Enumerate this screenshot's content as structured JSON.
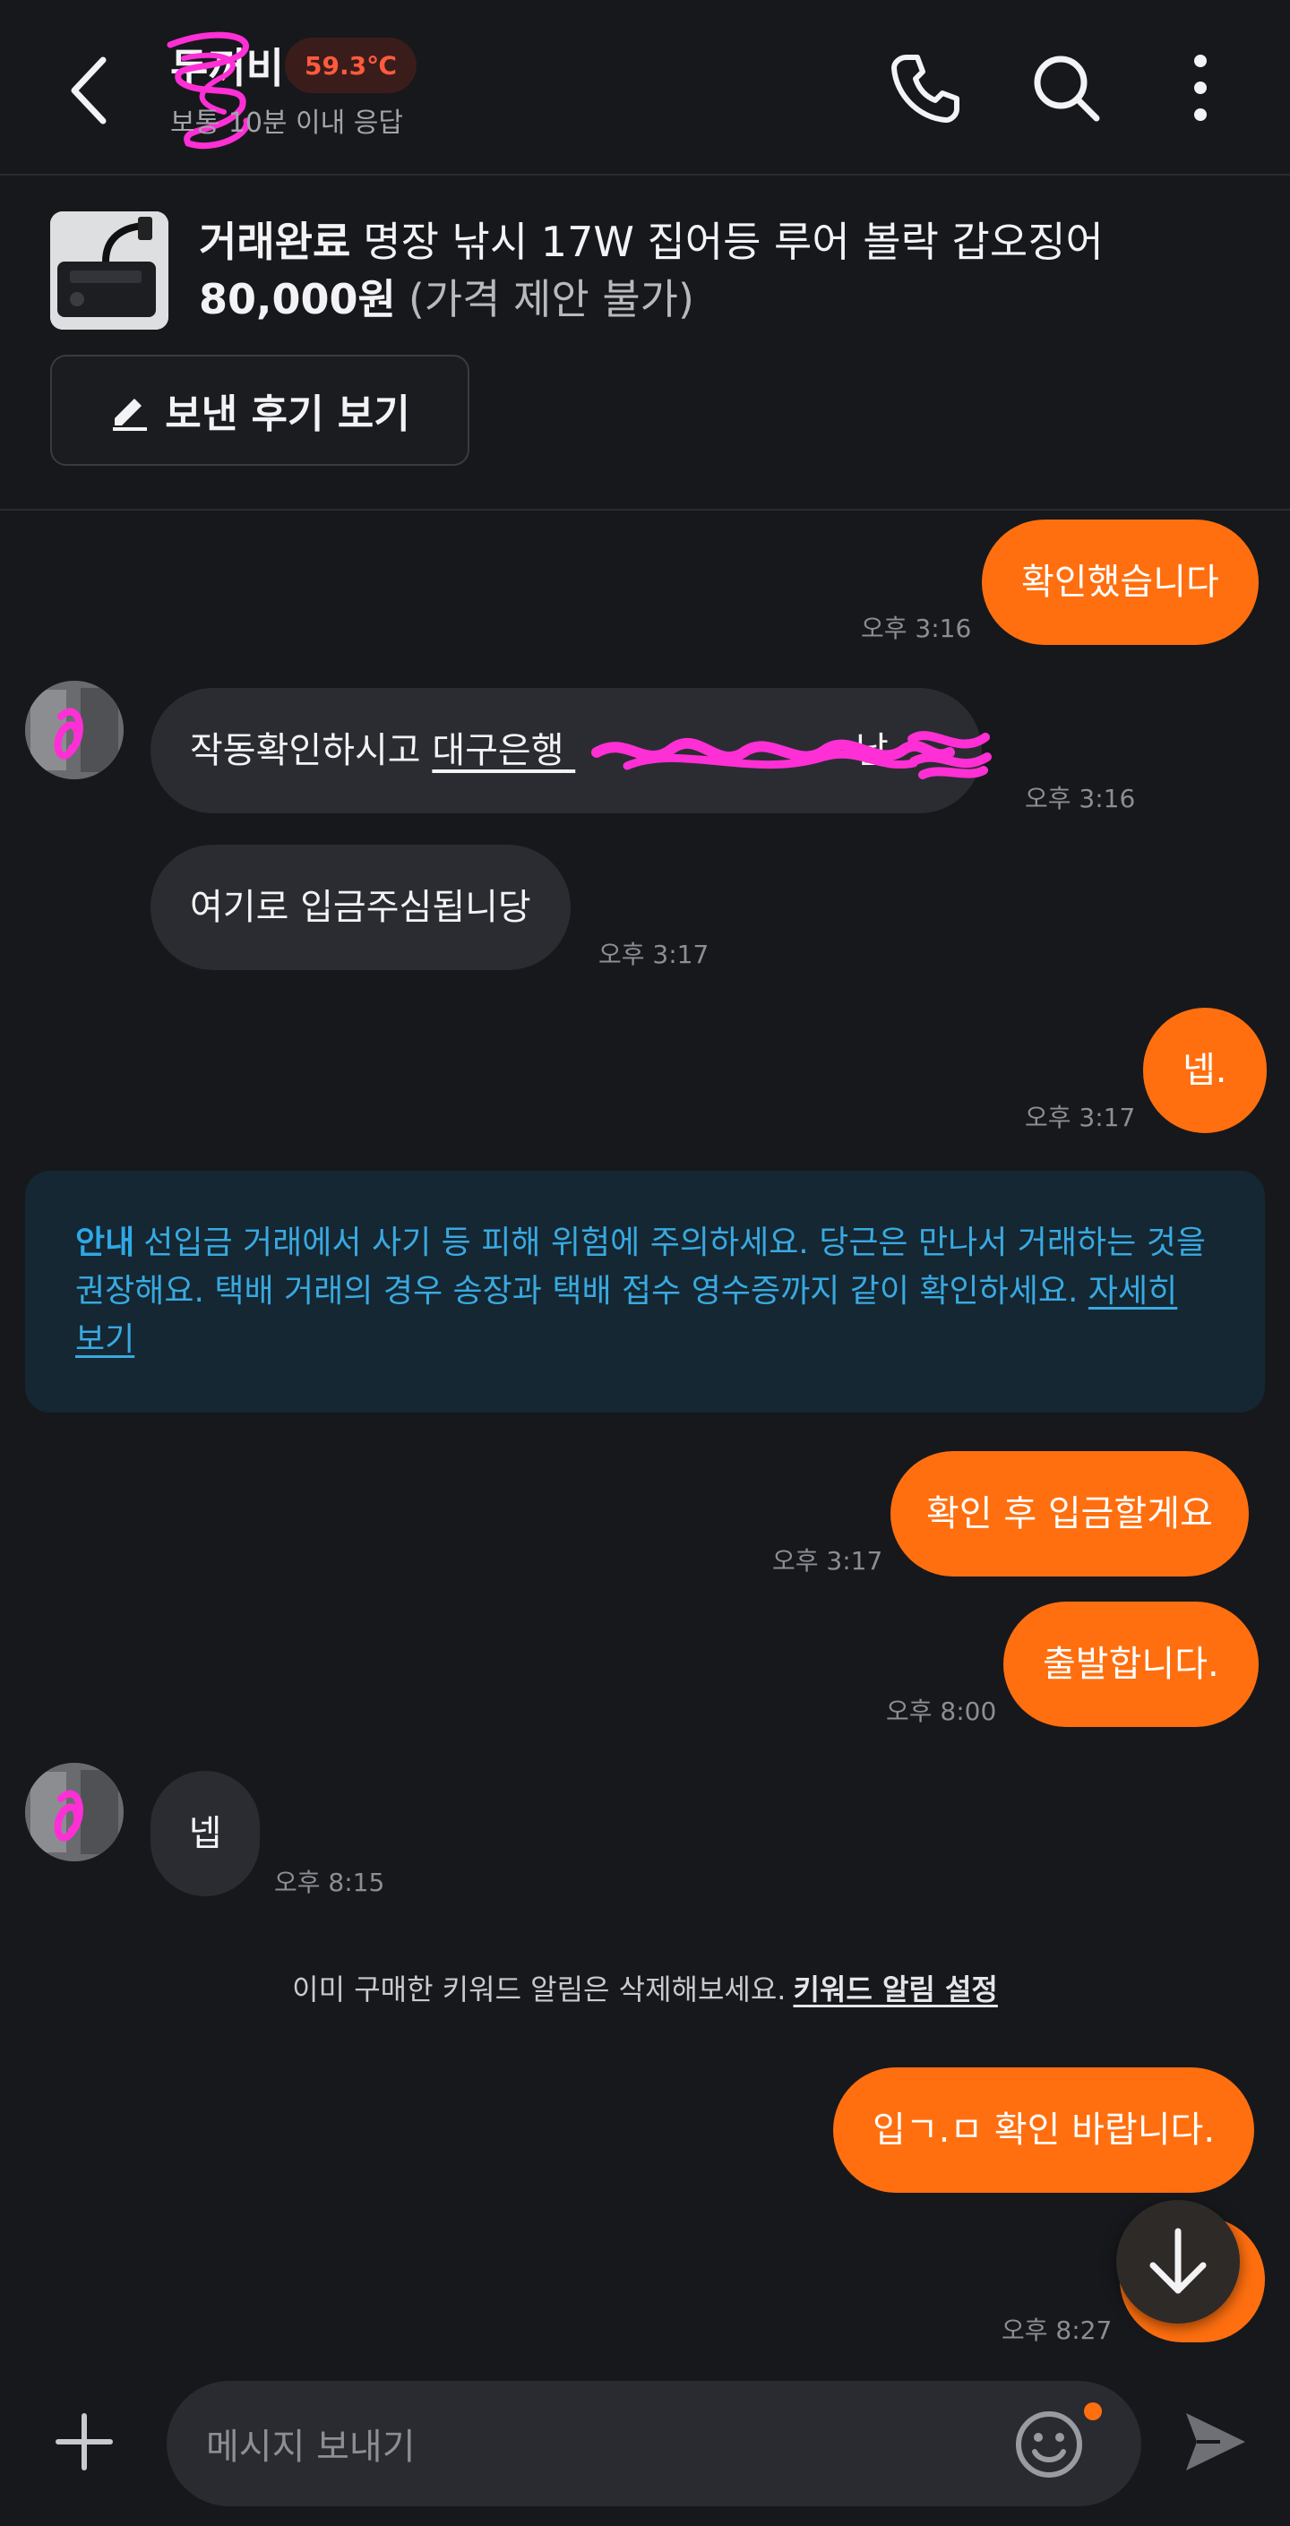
{
  "header": {
    "peer_name": "두꺼비",
    "temperature": "59.3℃",
    "response_time": "보통 10분 이내 응답"
  },
  "product": {
    "status": "거래완료",
    "title": "명장 낚시 17W 집어등 루어 볼락 갑오징어",
    "price": "80,000원",
    "price_note": "(가격 제안 불가)",
    "review_button": "보낸 후기 보기"
  },
  "messages": [
    {
      "sender": "me",
      "text": "확인했습니다",
      "time": "오후 3:16"
    },
    {
      "sender": "them",
      "text_prefix": "작동확인하시고 ",
      "bank": "대구은행",
      "account": "",
      "text_suffix": " 남",
      "time": "오후 3:16"
    },
    {
      "sender": "them",
      "text": "여기로 입금주심됩니당",
      "time": "오후 3:17"
    },
    {
      "sender": "me",
      "text": "넵.",
      "time": "오후 3:17"
    },
    {
      "sender": "me",
      "text": "확인 후 입금할게요",
      "time": "오후 3:17"
    },
    {
      "sender": "me",
      "text": "출발합니다.",
      "time": "오후 8:00"
    },
    {
      "sender": "them",
      "text": "넵",
      "time": "오후 8:15"
    },
    {
      "sender": "me",
      "text": "입ㄱ.ㅁ 확인 바랍니다.",
      "time": ""
    },
    {
      "sender": "me",
      "text": "",
      "time": "오후 8:27"
    }
  ],
  "notice": {
    "label": "안내",
    "text": "선입금 거래에서 사기 등 피해 위험에 주의하세요. 당근은 만나서 거래하는 것을 권장해요. 택배 거래의 경우 송장과 택배 접수 영수증까지 같이 확인하세요. ",
    "link": "자세히 보기"
  },
  "system": {
    "text": "이미 구매한 키워드 알림은 삭제해보세요.",
    "link": "키워드 알림 설정"
  },
  "composer": {
    "placeholder": "메시지 보내기"
  },
  "colors": {
    "accent": "#ff6f0f",
    "background": "#17181c",
    "their_bubble": "#2b2c31",
    "notice_bg": "#142733",
    "notice_text": "#39a9e0",
    "temperature": "#ff5a3d"
  },
  "icons": [
    "back-arrow-icon",
    "phone-icon",
    "search-icon",
    "more-vertical-icon",
    "pencil-icon",
    "arrow-down-icon",
    "plus-icon",
    "smile-icon",
    "send-icon"
  ]
}
